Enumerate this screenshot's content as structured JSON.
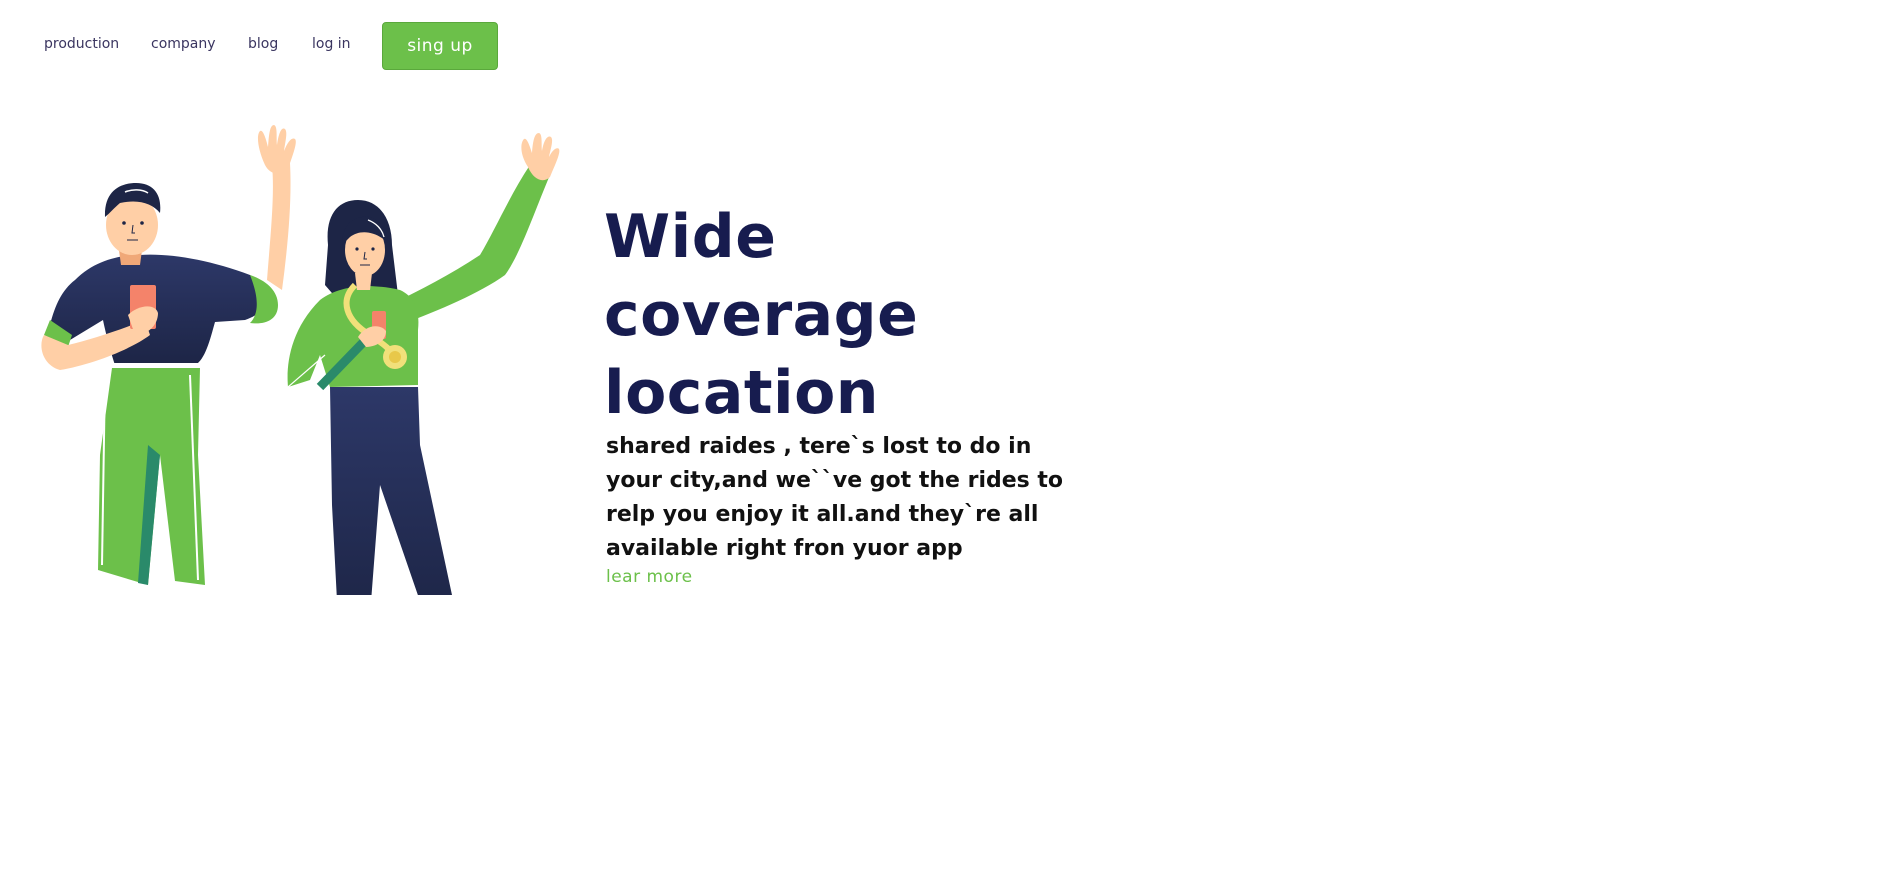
{
  "nav": {
    "items": [
      {
        "label": "production"
      },
      {
        "label": "company"
      },
      {
        "label": "blog"
      },
      {
        "label": "log in"
      }
    ],
    "signup_label": "sing up"
  },
  "hero": {
    "title_lines": [
      "Wide",
      "coverage",
      "location"
    ],
    "description": "shared raides , tere`s lost to do in your city,and we``ve got the rides to relp you enjoy it all.and they`re all available right fron yuor app",
    "link_label": "lear more"
  },
  "colors": {
    "accent_green": "#6cc04a",
    "title_navy": "#171c4f",
    "nav_text": "#3a3560",
    "shirt_navy": "#222b4f",
    "skin": "#ffcfa6"
  },
  "illustration": {
    "name": "two-people-waving-illustration"
  }
}
